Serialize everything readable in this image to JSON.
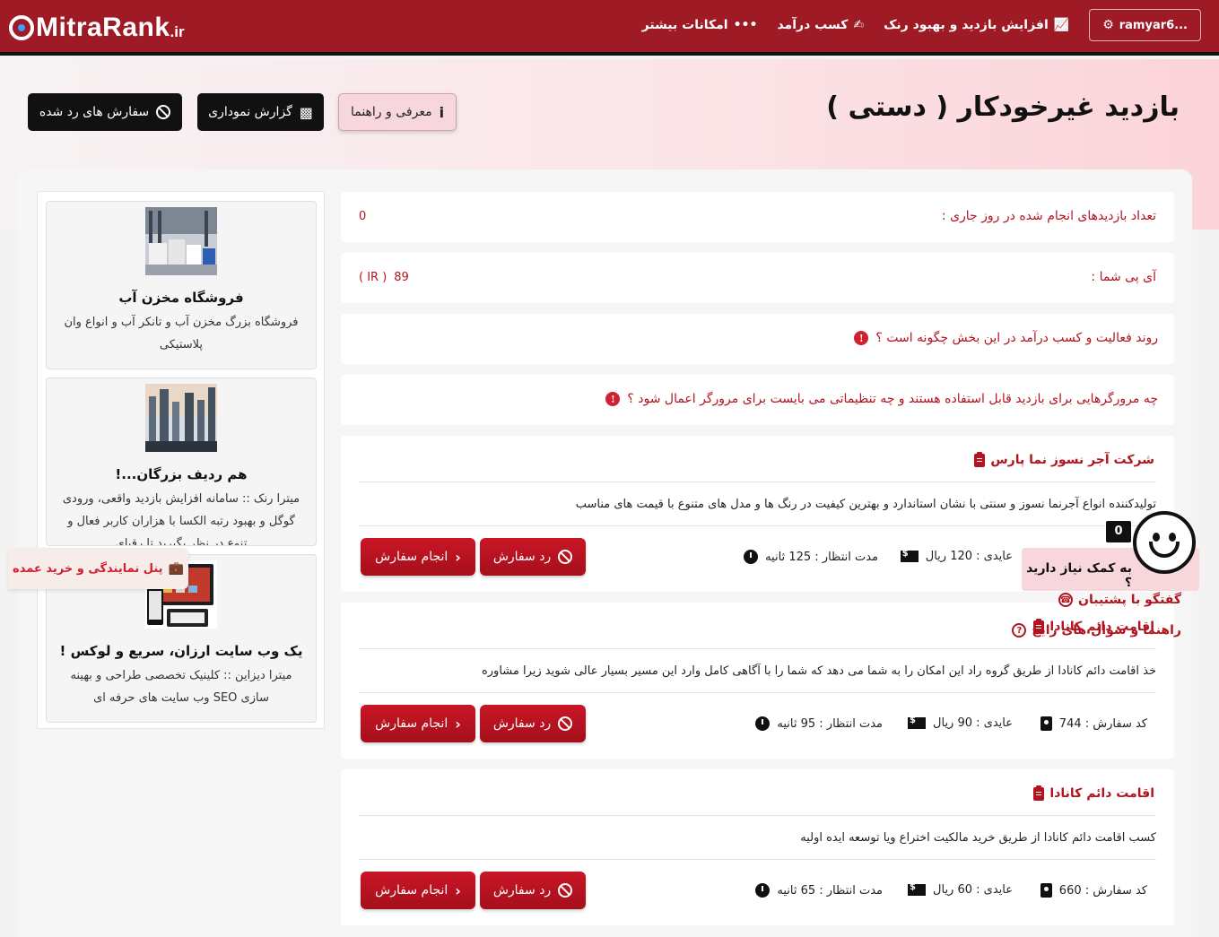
{
  "header": {
    "logo_text": "MitraRank",
    "logo_tld": ".ir",
    "user_label": "ramyar6...",
    "nav": [
      {
        "label": "افزایش بازدید و بهبود رنک"
      },
      {
        "label": "کسب درآمد"
      },
      {
        "label": "امکانات بیشتر"
      }
    ]
  },
  "page": {
    "title": "بازدید غیرخودکار ( دستی )",
    "buttons": {
      "guide": "معرفی و راهنما",
      "chart": "گزارش نموداری",
      "rejected": "سفارش های رد شده"
    }
  },
  "stats": {
    "visits_label": "تعداد بازدیدهای انجام شده در روز جاری :",
    "visits_value": "0",
    "ip_label": "آی پی شما :",
    "ip_value": "89",
    "ip_country": "( IR )"
  },
  "questions": [
    "روند فعالیت و کسب درآمد در این بخش چگونه است ؟",
    "چه مرورگرهایی برای بازدید قابل استفاده هستند و چه تنظیماتی می بایست برای مرورگر اعمال شود ؟"
  ],
  "labels": {
    "reject": "رد سفارش",
    "do": "انجام سفارش"
  },
  "jobs": [
    {
      "title": "شرکت آجر نسوز نما پارس",
      "desc": "تولیدکننده انواع آجرنما نسوز و سنتی با نشان استاندارد و بهترین کیفیت در رنگ ها و مدل های متنوع با قیمت های مناسب",
      "code": "",
      "reward": "عایدی : 120 ریال",
      "wait": "مدت انتظار : 125 ثانیه"
    },
    {
      "title": "اقامت دائم کانادا",
      "desc": "خذ اقامت دائم کانادا از طریق گروه راد این امکان را به شما می دهد که شما را با آگاهی کامل وارد این مسیر بسیار عالی شوید زیرا مشاوره",
      "code": "کد سفارش : 744",
      "reward": "عایدی : 90 ریال",
      "wait": "مدت انتظار : 95 ثانیه"
    },
    {
      "title": "اقامت دائم کانادا",
      "desc": "کسب اقامت دائم کانادا از طریق خرید مالکیت اختراع ویا توسعه ایده اولیه",
      "code": "کد سفارش : 660",
      "reward": "عایدی : 60 ریال",
      "wait": "مدت انتظار : 65 ثانیه"
    }
  ],
  "ads": [
    {
      "title": "فروشگاه مخزن آب",
      "text": "فروشگاه بزرگ مخزن آب و تانکر آب و انواع وان پلاستیکی"
    },
    {
      "title": "هم ردیف بزرگان...!",
      "text": "میترا رنک :: سامانه افزایش بازدید واقعی، ورودی گوگل و بهبود رتبه الکسا با هزاران کاربر فعال و تنوع در نظر بگیرید تا رقبای"
    },
    {
      "title": "یک وب سایت ارزان، سریع و لوکس !",
      "text": "میترا دیزاین :: کلینیک تخصصی طراحی و بهینه سازی SEO وب سایت های حرفه ای"
    }
  ],
  "widgets": {
    "reseller": "پنل نمایندگی و خرید عمده",
    "help_question": "به کمک نیاز دارید ؟",
    "unread": "0",
    "support_chat": "گفتگو با پشتیبان",
    "faq": "راهنما و سوال های رایج"
  },
  "colors": {
    "brand": "#9e1a25",
    "accent": "#b3141f",
    "button": "#c91626"
  }
}
